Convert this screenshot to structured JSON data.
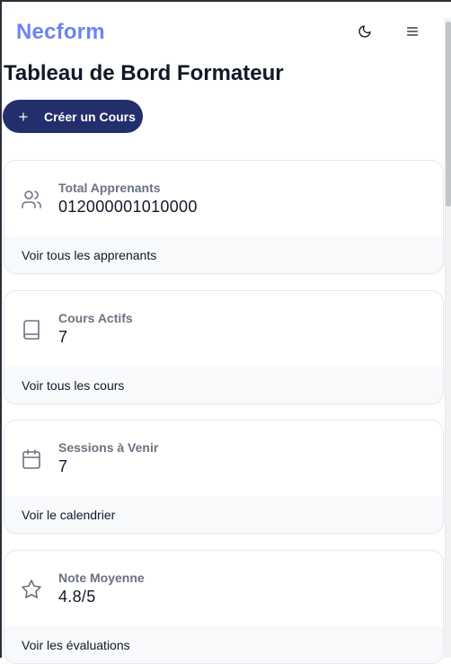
{
  "header": {
    "logo": "Necform",
    "theme_icon": "moon-icon",
    "menu_icon": "hamburger-menu-icon"
  },
  "page": {
    "title": "Tableau de Bord Formateur",
    "create_button": "Créer un Cours"
  },
  "cards": [
    {
      "icon": "users-icon",
      "title": "Total Apprenants",
      "value": "012000001010000",
      "link": "Voir tous les apprenants"
    },
    {
      "icon": "book-icon",
      "title": "Cours Actifs",
      "value": "7",
      "link": "Voir tous les cours"
    },
    {
      "icon": "calendar-icon",
      "title": "Sessions à Venir",
      "value": "7",
      "link": "Voir le calendrier"
    },
    {
      "icon": "star-icon",
      "title": "Note Moyenne",
      "value": "4.8/5",
      "link": "Voir les évaluations"
    }
  ],
  "colors": {
    "brand": "#6d82f5",
    "primary_button": "#232f6d",
    "muted_text": "#6b7280",
    "card_footer_bg": "#f8f9fb"
  }
}
